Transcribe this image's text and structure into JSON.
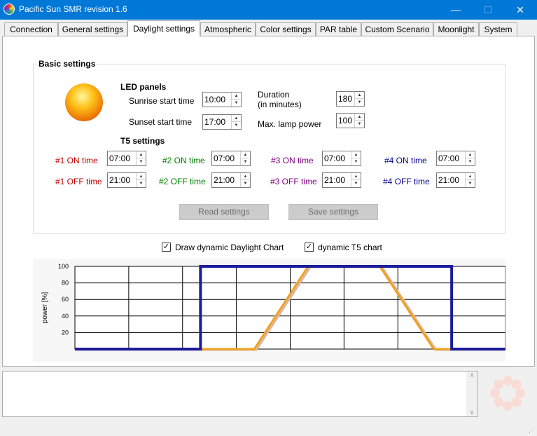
{
  "window": {
    "title": "Pacific Sun SMR revision 1.6",
    "minimize": "—",
    "maximize": "☐",
    "close": "✕"
  },
  "tabs": [
    "Connection",
    "General settings",
    "Daylight settings",
    "Atmospheric",
    "Color settings",
    "PAR table",
    "Custom Scenario",
    "Moonlight",
    "System"
  ],
  "active_tab": "Daylight settings",
  "basic": {
    "title": "Basic settings",
    "led_title": "LED panels",
    "sunrise_label": "Sunrise start time",
    "sunrise_value": "10:00",
    "sunset_label": "Sunset start time",
    "sunset_value": "17:00",
    "duration_label_1": "Duration",
    "duration_label_2": "(in minutes)",
    "duration_value": "180",
    "maxpower_label": "Max. lamp power",
    "maxpower_value": "100",
    "t5_title": "T5 settings",
    "t5": [
      {
        "on_label": "#1 ON time",
        "on_value": "07:00",
        "off_label": "#1 OFF time",
        "off_value": "21:00",
        "color": "#c00000"
      },
      {
        "on_label": "#2 ON time",
        "on_value": "07:00",
        "off_label": "#2 OFF time",
        "off_value": "21:00",
        "color": "#008000"
      },
      {
        "on_label": "#3 ON time",
        "on_value": "07:00",
        "off_label": "#3 OFF time",
        "off_value": "21:00",
        "color": "#800080"
      },
      {
        "on_label": "#4 ON time",
        "on_value": "07:00",
        "off_label": "#4 OFF time",
        "off_value": "21:00",
        "color": "#00008b"
      }
    ],
    "read_button": "Read settings",
    "save_button": "Save settings"
  },
  "options": {
    "daylight_chart_label": "Draw dynamic Daylight Chart",
    "daylight_chart_checked": true,
    "t5_chart_label": "dynamic T5 chart",
    "t5_chart_checked": true
  },
  "chart_data": {
    "type": "line",
    "ylabel": "power [%]",
    "xlabel": "",
    "y_ticks": [
      "100",
      "80",
      "60",
      "40",
      "20"
    ],
    "ylim": [
      0,
      100
    ],
    "xlim": [
      0,
      24
    ],
    "grid": true,
    "series": [
      {
        "color": "#1c1c9c",
        "x": [
          0,
          7,
          7,
          21,
          21,
          24
        ],
        "y": [
          0,
          0,
          100,
          100,
          0,
          0
        ]
      },
      {
        "color": "#f0a020",
        "x": [
          0,
          10,
          13,
          17,
          20,
          24
        ],
        "y": [
          0,
          0,
          100,
          100,
          0,
          0
        ]
      }
    ]
  },
  "colors": {
    "accent": "#0078d7",
    "t5_line": "#1c1c9c",
    "led_line": "#f0a020"
  }
}
